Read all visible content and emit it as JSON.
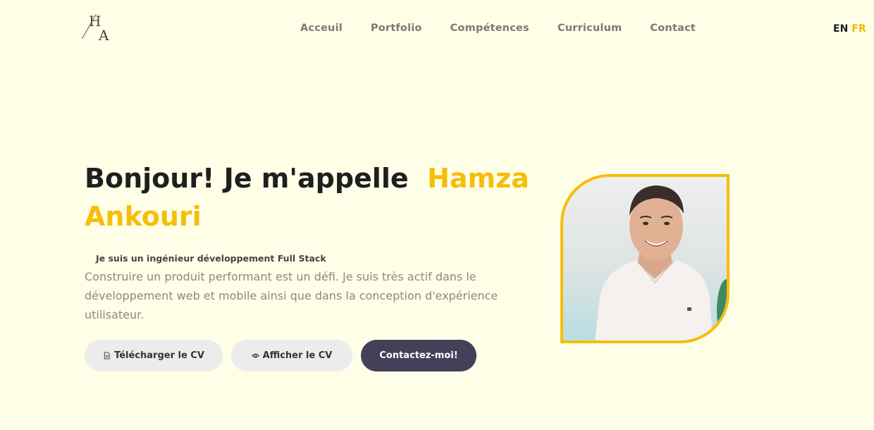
{
  "logo": {
    "letter_top": "H",
    "letter_bottom": "A"
  },
  "nav": {
    "items": [
      {
        "label": "Acceuil"
      },
      {
        "label": "Portfolio"
      },
      {
        "label": "Compétences"
      },
      {
        "label": "Curriculum"
      },
      {
        "label": "Contact"
      }
    ]
  },
  "lang": {
    "en": "EN",
    "fr": "FR"
  },
  "hero": {
    "greeting": "Bonjour! Je m'appelle",
    "name": "Hamza Ankouri",
    "role": "Je suis un ingénieur développement Full Stack",
    "description": "Construire un produit performant est un défi. Je suis très actif dans le développement web et mobile ainsi que dans la conception d'expérience utilisateur.",
    "buttons": {
      "download_cv": "Télécharger le CV",
      "view_cv": "Afficher le CV",
      "contact": "Contactez-moi!"
    }
  },
  "colors": {
    "background": "#ffffe8",
    "accent": "#f5be0b",
    "dark_button": "#43415a"
  },
  "icons": {
    "download_cv": "document-icon",
    "view_cv": "eye-icon"
  }
}
